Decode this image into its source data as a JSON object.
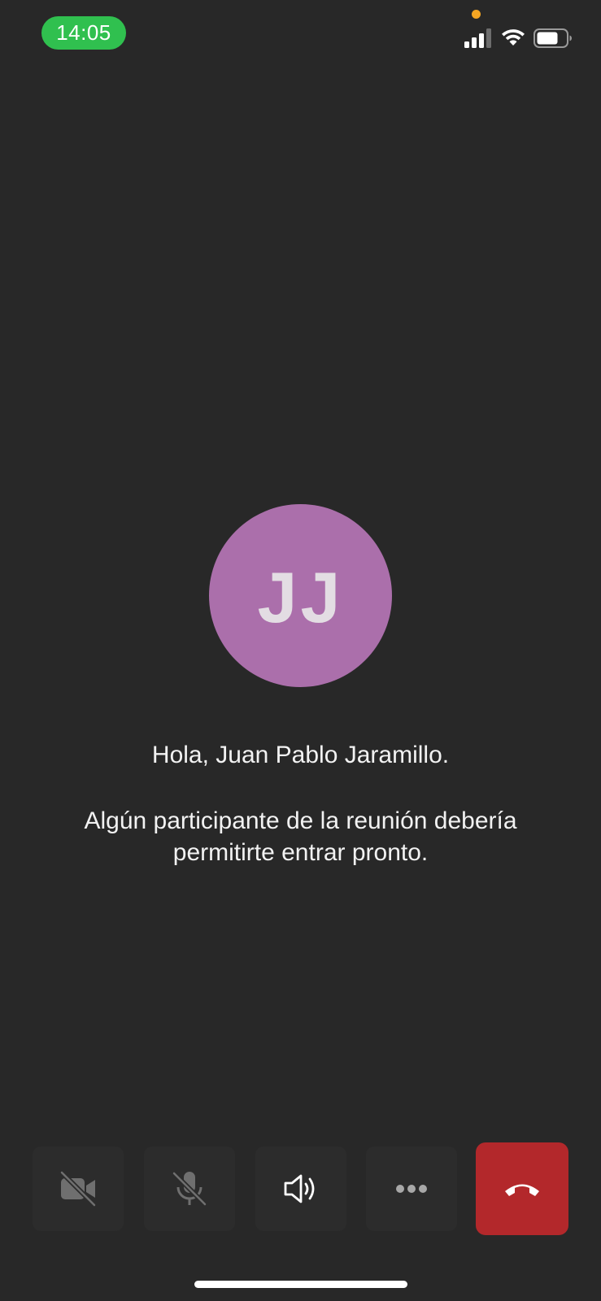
{
  "status_bar": {
    "time": "14:05",
    "signal_icon": "cellular-signal-icon",
    "wifi_icon": "wifi-icon",
    "battery_icon": "battery-icon",
    "privacy_indicator_color": "#f5a623"
  },
  "participant": {
    "initials": "JJ",
    "avatar_color": "#ab6fab"
  },
  "lobby": {
    "greeting": "Hola, Juan Pablo Jaramillo.",
    "message": "Algún participante de la reunión debería permitirte entrar pronto."
  },
  "toolbar": {
    "buttons": [
      {
        "icon": "video-off-icon",
        "state": "off"
      },
      {
        "icon": "mic-off-icon",
        "state": "off"
      },
      {
        "icon": "speaker-icon",
        "state": "on"
      },
      {
        "icon": "more-icon"
      },
      {
        "icon": "hang-up-icon",
        "color": "#b3282b"
      }
    ]
  },
  "colors": {
    "background": "#282828",
    "time_pill": "#30c04f",
    "hangup": "#b3282b"
  }
}
